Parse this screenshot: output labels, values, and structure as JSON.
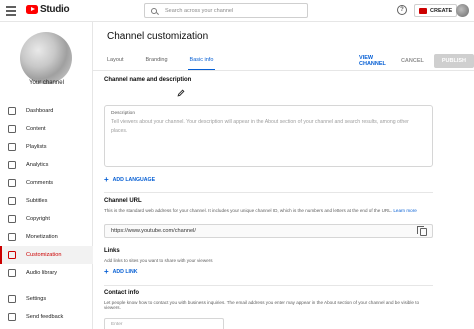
{
  "app": {
    "logo_text": "Studio",
    "search_placeholder": "Search across your channel",
    "create_label": "CREATE",
    "help_icon": "help-icon"
  },
  "sidebar": {
    "channel_label": "Your channel",
    "items": [
      {
        "label": "Dashboard",
        "icon": "dashboard-icon",
        "active": false
      },
      {
        "label": "Content",
        "icon": "content-icon",
        "active": false
      },
      {
        "label": "Playlists",
        "icon": "playlists-icon",
        "active": false
      },
      {
        "label": "Analytics",
        "icon": "analytics-icon",
        "active": false
      },
      {
        "label": "Comments",
        "icon": "comments-icon",
        "active": false
      },
      {
        "label": "Subtitles",
        "icon": "subtitles-icon",
        "active": false
      },
      {
        "label": "Copyright",
        "icon": "copyright-icon",
        "active": false
      },
      {
        "label": "Monetization",
        "icon": "monetization-icon",
        "active": false
      },
      {
        "label": "Customization",
        "icon": "customization-icon",
        "active": true
      },
      {
        "label": "Audio library",
        "icon": "audio-library-icon",
        "active": false
      }
    ],
    "bottom_items": [
      {
        "label": "Settings",
        "icon": "settings-icon"
      },
      {
        "label": "Send feedback",
        "icon": "feedback-icon"
      }
    ]
  },
  "main": {
    "title": "Channel customization",
    "tabs": [
      {
        "label": "Layout",
        "active": false
      },
      {
        "label": "Branding",
        "active": false
      },
      {
        "label": "Basic info",
        "active": true
      }
    ],
    "actions": {
      "view_channel": "VIEW CHANNEL",
      "cancel": "CANCEL",
      "publish": "PUBLISH"
    },
    "name_section": {
      "title": "Channel name and description"
    },
    "description": {
      "label": "Description",
      "placeholder": "Tell viewers about your channel. Your description will appear in the About section of your channel and search results, among other places."
    },
    "add_language": "ADD LANGUAGE",
    "url_section": {
      "title": "Channel URL",
      "desc": "This is the standard web address for your channel. It includes your unique channel ID, which is the numbers and letters at the end of the URL.",
      "learn_more": "Learn more",
      "url": "https://www.youtube.com/channel/"
    },
    "links_section": {
      "title": "Links",
      "desc": "Add links to sites you want to share with your viewers",
      "add_link": "ADD LINK"
    },
    "contact_section": {
      "title": "Contact info",
      "desc": "Let people know how to contact you with business inquiries. The email address you enter may appear in the About section of your channel and be visible to viewers.",
      "email_placeholder": "Enter"
    }
  },
  "colors": {
    "accent_red": "#cc0000",
    "link_blue": "#065fd4"
  }
}
